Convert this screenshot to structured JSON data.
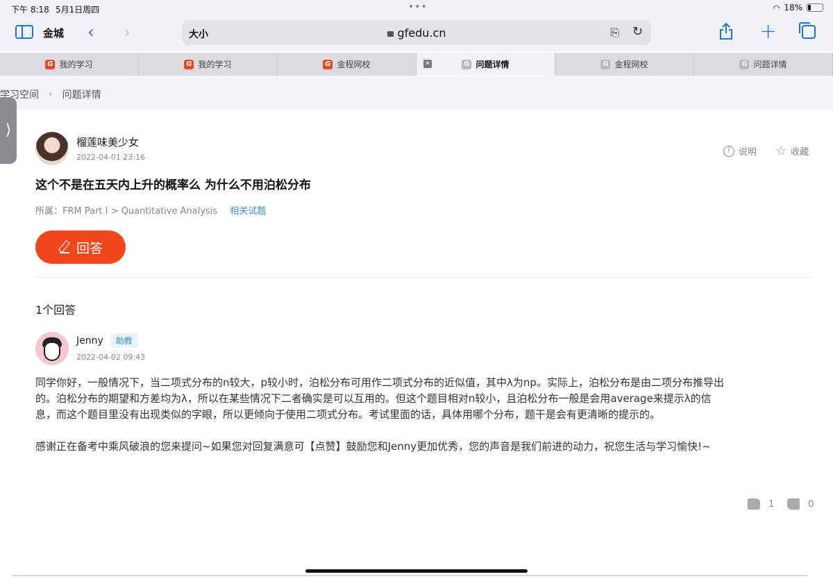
{
  "status_bar": {
    "time": "下午 8:18",
    "date": "5月1日周四",
    "battery": "18%",
    "battery_level": 0.18
  },
  "toolbar": {
    "tab_group": "金城",
    "text_size": "大小",
    "url": "gfedu.cn"
  },
  "tabs": [
    {
      "label": "我的学习",
      "favicon": "gf-logo-icon",
      "active": false
    },
    {
      "label": "我的学习",
      "favicon": "gf-logo-icon",
      "active": false
    },
    {
      "label": "金程网校",
      "favicon": "gf-logo-icon",
      "active": false
    },
    {
      "label": "问题详情",
      "favicon": "g-letter-icon",
      "active": true,
      "close": "✕"
    },
    {
      "label": "金程网校",
      "favicon": "g-letter-icon",
      "active": false
    },
    {
      "label": "问题详情",
      "favicon": "g-letter-icon",
      "active": false
    }
  ],
  "breadcrumb": {
    "home": "学习空间",
    "current": "问题详情"
  },
  "question": {
    "user": "榴莲味美少女",
    "time": "2022-04-01 23:16",
    "report": "说明",
    "favorite": "收藏",
    "title": "这个不是在五天内上升的概率么 为什么不用泊松分布",
    "category": "所属：FRM Part I > Quantitative Analysis",
    "related_link": "相关试题",
    "answer_button": "回答"
  },
  "answers_header": "1个回答",
  "answer": {
    "user": "Jenny",
    "badge": "助教",
    "time": "2022-04-02 09:43",
    "paragraphs": [
      "同学你好，一般情况下，当二项式分布的n较大，p较小时，泊松分布可用作二项式分布的近似值，其中λ为np。实际上，泊松分布是由二项分布推导出的。泊松分布的期望和方差均为λ，所以在某些情况下二者确实是可以互用的。但这个题目相对n较小，且泊松分布一般是会用average来提示λ的信息，而这个题目里没有出现类似的字眼，所以更倾向于使用二项式分布。考试里面的话，具体用哪个分布，题干是会有更清晰的提示的。",
      "感谢正在备考中乘风破浪的您来提问~如果您对回复满意可【点赞】鼓励您和Jenny更加优秀，您的声音是我们前进的动力，祝您生活与学习愉快!~"
    ],
    "likes": "1",
    "dislikes": "0"
  },
  "colors": {
    "accent": "#1a73e8",
    "answer_button": "#f0471c",
    "link": "#3a8fd9"
  }
}
